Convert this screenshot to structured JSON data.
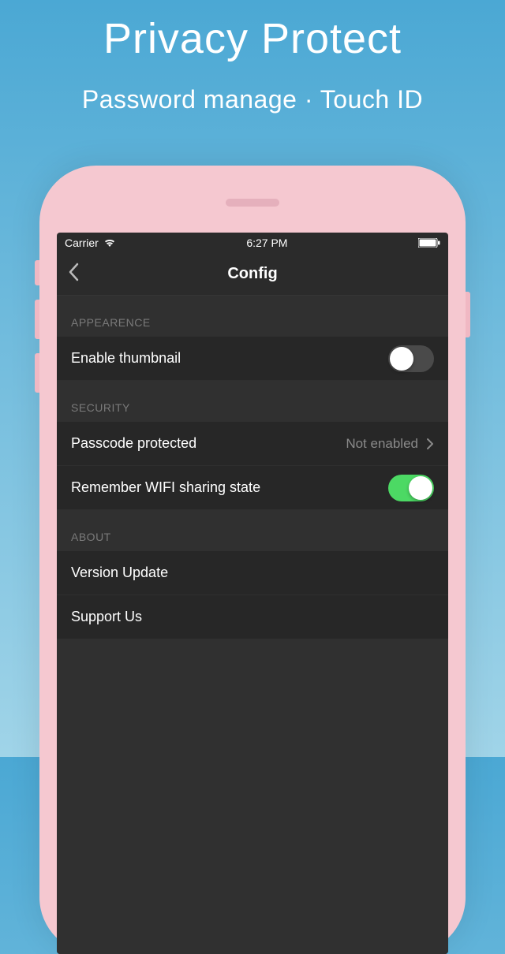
{
  "hero": {
    "title": "Privacy Protect",
    "subtitle": "Password manage · Touch ID"
  },
  "statusBar": {
    "carrier": "Carrier",
    "time": "6:27 PM"
  },
  "nav": {
    "title": "Config"
  },
  "sections": {
    "appearance": {
      "header": "APPEARENCE",
      "enableThumbnail": {
        "label": "Enable thumbnail",
        "on": false
      }
    },
    "security": {
      "header": "SECURITY",
      "passcode": {
        "label": "Passcode protected",
        "value": "Not enabled"
      },
      "rememberWifi": {
        "label": "Remember WIFI sharing state",
        "on": true
      }
    },
    "about": {
      "header": "ABOUT",
      "versionUpdate": {
        "label": "Version Update"
      },
      "supportUs": {
        "label": "Support Us"
      }
    }
  }
}
